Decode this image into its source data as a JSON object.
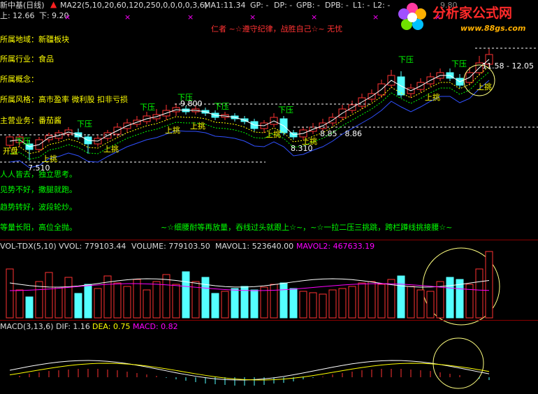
{
  "header": {
    "title": "新中基(日线)",
    "indicator_name": "MA22(5,10,20,60,120,250,0,0,0,0,3,6)",
    "ma1_label": "MA1:",
    "ma1_value": "11.34",
    "gp": "GP: -",
    "dp": "DP: -",
    "gpb": "GPB: -",
    "dpb": "DPB: -",
    "l1": "L1: -",
    "l2": "L2: -",
    "top_value": "9.80",
    "up_label": "上:",
    "up_value": "12.66",
    "down_label": "下:",
    "down_value": "9.20",
    "slogan": "仁者 ~☆遵守纪律，战胜自己☆~ 无忧"
  },
  "watermark": {
    "brand": "分析家公式网",
    "url": "www.88gs.com"
  },
  "info_lines": [
    "所属地域：新疆板块",
    "所属行业：食品",
    "所属概念：",
    "所属风格：高市盈率 微利股 扣非亏损",
    "主营业务：番茄酱"
  ],
  "advice_lines": [
    "人人皆去，独立思考。",
    "见势不好，撒腿就跑。",
    "趋势转好，波段轮炒。",
    "等量长阳，高位全抛。"
  ],
  "bottom_slogan": "~☆细腰耐等再放量，吞线过头就跟上☆~，~☆一拉二压三挑跳，跨栏蹲线挑接腰☆~",
  "price_marks": {
    "high": "9.800",
    "low": "7.510",
    "low2": "8.310",
    "range1": "8.85 - 8.86",
    "range2": "11.58 - 12.05",
    "first_label": "开盘"
  },
  "signals": {
    "down": "下压",
    "up": "上挑"
  },
  "volume": {
    "title": "VOL-TDX(5,10)",
    "vvol": "VVOL: 779103.44",
    "volume": "VOLUME: 779103.50",
    "mavol1": "MAVOL1: 523640.00",
    "mavol2": "MAVOL2: 467633.19"
  },
  "macd": {
    "title": "MACD(3,13,6)",
    "dif": "DIF: 1.16",
    "dea": "DEA: 0.75",
    "macd": "MACD: 0.82"
  },
  "colors": {
    "up": "#ff3232",
    "down": "#54ffff",
    "yellow": "#ffff00",
    "green": "#00ff00",
    "magenta": "#ff00ff",
    "slogan_red": "#ff3232"
  }
}
